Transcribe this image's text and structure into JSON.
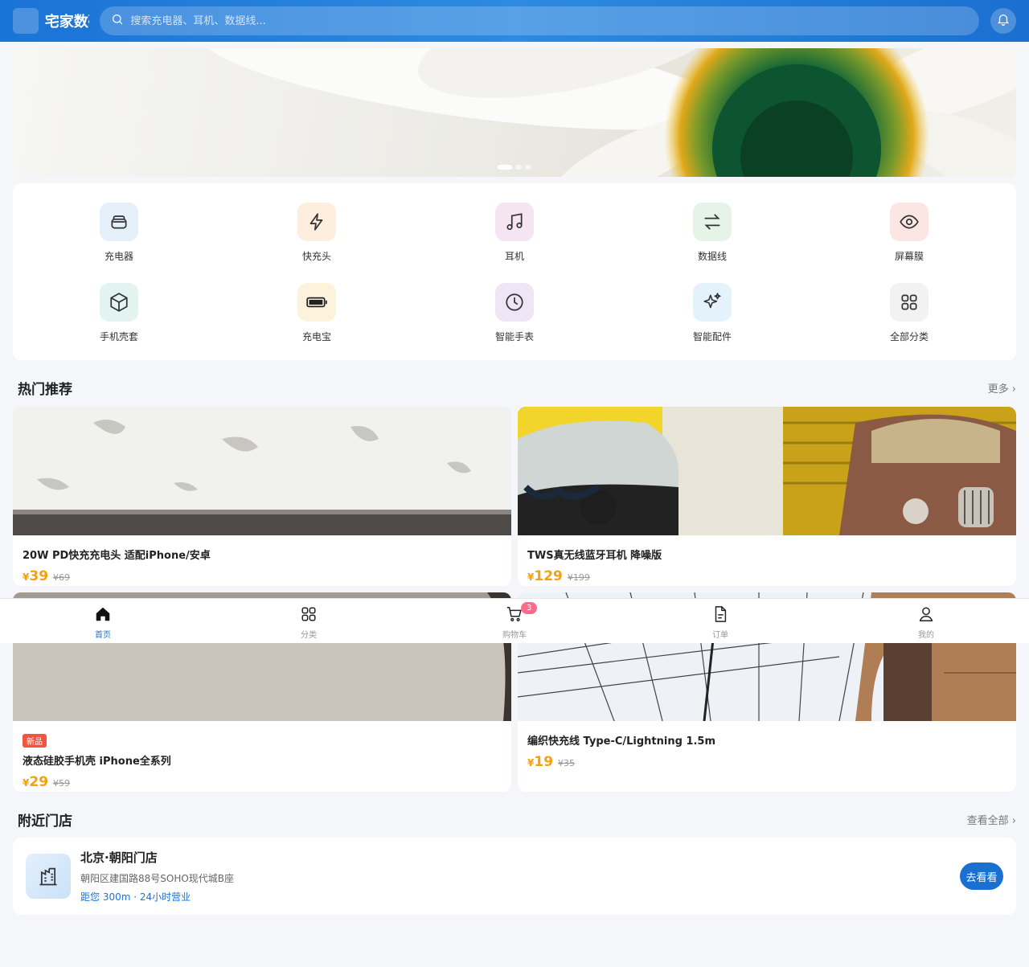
{
  "header": {
    "logo_glyph": "",
    "brand": "宅家数码",
    "search_placeholder": "搜索充电器、耳机、数据线...",
    "colors": {
      "primary": "#1a73d6",
      "accent": "#f5a10d"
    }
  },
  "banner": {
    "slides": 3,
    "active": 1
  },
  "categories": [
    {
      "label": "充电器",
      "icon": "layers-icon",
      "bg": "#e6f0fb"
    },
    {
      "label": "快充头",
      "icon": "lightning-icon",
      "bg": "#fdeede"
    },
    {
      "label": "耳机",
      "icon": "music-note-icon",
      "bg": "#f5e4f1"
    },
    {
      "label": "数据线",
      "icon": "swap-arrows-icon",
      "bg": "#e6f4e8"
    },
    {
      "label": "屏幕膜",
      "icon": "eye-icon",
      "bg": "#fbe6e4"
    },
    {
      "label": "手机壳套",
      "icon": "box-icon",
      "bg": "#e3f3f0"
    },
    {
      "label": "充电宝",
      "icon": "battery-icon",
      "bg": "#fdf3dc"
    },
    {
      "label": "智能手表",
      "icon": "clock-icon",
      "bg": "#efe6f5"
    },
    {
      "label": "智能配件",
      "icon": "sparkle-icon",
      "bg": "#e3f2fb"
    },
    {
      "label": "全部分类",
      "icon": "grid-icon",
      "bg": "#f2f2f2"
    }
  ],
  "hot": {
    "title_mark": "",
    "title": "热门推荐",
    "more": "更多 ›",
    "products": [
      {
        "name": "20W PD快充充电头 适配iPhone/安卓",
        "currency": "¥",
        "price": "39",
        "old_price": "¥69",
        "tag": ""
      },
      {
        "name": "TWS真无线蓝牙耳机 降噪版",
        "currency": "¥",
        "price": "129",
        "old_price": "¥199",
        "tag": ""
      },
      {
        "name": "液态硅胶手机壳 iPhone全系列",
        "currency": "¥",
        "price": "29",
        "old_price": "¥59",
        "tag": "新品"
      },
      {
        "name": "编织快充线 Type-C/Lightning 1.5m",
        "currency": "¥",
        "price": "19",
        "old_price": "¥35",
        "tag": ""
      }
    ]
  },
  "store_section": {
    "title_mark": "",
    "title": "附近门店",
    "more": "查看全部 ›",
    "store": {
      "name": "北京·朝阳门店",
      "address": "朝阳区建国路88号SOHO现代城B座",
      "distance": "距您 300m · 24小时营业",
      "button": "去看看"
    }
  },
  "tabbar": {
    "items": [
      {
        "label": "首页",
        "icon": "home-icon",
        "active": true
      },
      {
        "label": "分类",
        "icon": "grid-icon",
        "active": false
      },
      {
        "label": "购物车",
        "icon": "cart-icon",
        "active": false,
        "badge": "3"
      },
      {
        "label": "订单",
        "icon": "document-icon",
        "active": false
      },
      {
        "label": "我的",
        "icon": "user-icon",
        "active": false
      }
    ]
  }
}
